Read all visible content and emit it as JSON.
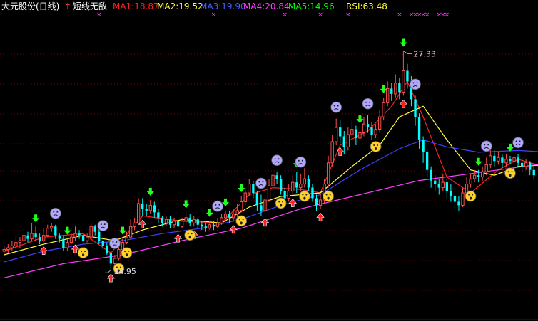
{
  "header": {
    "title": "大元股份(日线)",
    "indicator_arrow": "↑",
    "indicator_name": "短线无敌",
    "ma1": "MA1:18.87",
    "ma2": "MA2:19.52",
    "ma3": "MA3:19.90",
    "ma4": "MA4:20.84",
    "ma5": "MA5:14.96",
    "rsi": "RSI:63.48"
  },
  "colors": {
    "background": "#000000",
    "grid": "#7a0000",
    "up": "#ff5050",
    "down": "#00ffff",
    "ma1": "#ff2020",
    "ma2": "#ffff40",
    "ma3": "#4040ff",
    "ma4": "#ff40ff",
    "ma5": "#00ff00",
    "rsi": "#ffff40",
    "title": "#ffffff",
    "signal_x": "#ff40ff"
  },
  "chart_data": {
    "type": "candlestick",
    "ylim": [
      12.5,
      29.0
    ],
    "grid": true,
    "high_label": "27.33",
    "low_label": "14.95",
    "high_index": 101,
    "low_index": 27,
    "candles": [
      [
        16.0,
        16.1,
        15.8,
        16.3
      ],
      [
        16.1,
        16.2,
        15.9,
        16.4
      ],
      [
        16.2,
        16.3,
        16.0,
        16.6
      ],
      [
        16.3,
        16.5,
        16.1,
        16.9
      ],
      [
        16.5,
        16.6,
        16.2,
        16.8
      ],
      [
        16.6,
        16.9,
        16.4,
        17.2
      ],
      [
        16.9,
        16.7,
        16.5,
        17.1
      ],
      [
        16.7,
        17.0,
        16.6,
        17.6
      ],
      [
        17.0,
        16.8,
        16.6,
        17.4
      ],
      [
        16.8,
        16.6,
        16.4,
        17.0
      ],
      [
        16.6,
        16.9,
        16.5,
        17.3
      ],
      [
        16.9,
        17.3,
        16.8,
        17.5
      ],
      [
        17.3,
        17.4,
        17.1,
        17.6
      ],
      [
        17.4,
        16.9,
        16.7,
        17.5
      ],
      [
        16.9,
        16.7,
        16.5,
        17.0
      ],
      [
        16.7,
        16.2,
        16.0,
        16.9
      ],
      [
        16.2,
        16.5,
        16.0,
        16.7
      ],
      [
        16.5,
        16.8,
        16.4,
        17.0
      ],
      [
        16.8,
        17.0,
        16.6,
        17.4
      ],
      [
        17.0,
        16.9,
        16.7,
        17.2
      ],
      [
        16.9,
        16.6,
        16.4,
        17.0
      ],
      [
        16.6,
        16.8,
        16.5,
        17.0
      ],
      [
        16.8,
        17.4,
        16.7,
        17.6
      ],
      [
        17.4,
        17.1,
        16.9,
        17.5
      ],
      [
        17.1,
        16.6,
        16.4,
        17.3
      ],
      [
        16.6,
        16.3,
        16.1,
        16.8
      ],
      [
        16.3,
        15.9,
        15.8,
        16.5
      ],
      [
        15.9,
        15.3,
        14.95,
        16.0
      ],
      [
        15.3,
        15.6,
        15.1,
        15.8
      ],
      [
        15.6,
        16.1,
        15.5,
        16.3
      ],
      [
        16.1,
        16.5,
        16.0,
        16.7
      ],
      [
        16.5,
        16.8,
        16.4,
        17.1
      ],
      [
        16.8,
        17.4,
        16.7,
        17.8
      ],
      [
        17.4,
        17.6,
        17.2,
        17.9
      ],
      [
        17.6,
        18.7,
        17.5,
        19.0
      ],
      [
        18.7,
        18.4,
        18.0,
        19.0
      ],
      [
        18.4,
        18.3,
        18.0,
        18.7
      ],
      [
        18.3,
        18.6,
        18.1,
        18.9
      ],
      [
        18.6,
        18.2,
        17.9,
        18.8
      ],
      [
        18.2,
        17.9,
        17.6,
        18.4
      ],
      [
        17.9,
        17.6,
        17.4,
        18.0
      ],
      [
        17.6,
        17.8,
        17.4,
        18.0
      ],
      [
        17.8,
        17.5,
        17.3,
        18.0
      ],
      [
        17.5,
        17.7,
        17.3,
        17.9
      ],
      [
        17.7,
        17.4,
        17.2,
        17.8
      ],
      [
        17.4,
        17.7,
        17.3,
        17.9
      ],
      [
        17.7,
        17.9,
        17.5,
        18.2
      ],
      [
        17.9,
        17.6,
        17.4,
        18.1
      ],
      [
        17.6,
        17.8,
        17.4,
        18.0
      ],
      [
        17.8,
        17.5,
        17.3,
        17.9
      ],
      [
        17.5,
        17.4,
        17.2,
        17.7
      ],
      [
        17.4,
        17.3,
        17.1,
        17.6
      ],
      [
        17.3,
        17.5,
        17.2,
        17.7
      ],
      [
        17.5,
        17.4,
        17.2,
        17.7
      ],
      [
        17.4,
        17.6,
        17.3,
        17.9
      ],
      [
        17.6,
        17.9,
        17.5,
        18.1
      ],
      [
        17.9,
        18.1,
        17.7,
        18.3
      ],
      [
        18.1,
        17.9,
        17.6,
        18.3
      ],
      [
        17.9,
        18.1,
        17.7,
        18.4
      ],
      [
        18.1,
        18.3,
        17.9,
        18.7
      ],
      [
        18.3,
        18.8,
        18.2,
        19.1
      ],
      [
        18.8,
        19.3,
        18.6,
        19.6
      ],
      [
        19.3,
        19.8,
        19.1,
        20.1
      ],
      [
        19.8,
        19.3,
        19.0,
        20.0
      ],
      [
        19.3,
        18.6,
        18.3,
        19.4
      ],
      [
        18.6,
        18.3,
        18.0,
        19.2
      ],
      [
        18.3,
        18.9,
        18.1,
        19.5
      ],
      [
        18.9,
        19.7,
        18.8,
        20.1
      ],
      [
        19.7,
        20.3,
        19.5,
        20.7
      ],
      [
        20.3,
        20.1,
        19.8,
        20.5
      ],
      [
        20.1,
        19.4,
        19.2,
        20.3
      ],
      [
        19.4,
        19.0,
        18.7,
        19.6
      ],
      [
        19.0,
        19.4,
        18.8,
        19.8
      ],
      [
        19.4,
        19.9,
        19.2,
        20.3
      ],
      [
        19.9,
        19.6,
        19.3,
        20.5
      ],
      [
        19.6,
        19.8,
        19.4,
        20.4
      ],
      [
        19.8,
        20.1,
        19.6,
        20.7
      ],
      [
        20.1,
        19.6,
        19.4,
        20.3
      ],
      [
        19.6,
        19.0,
        18.8,
        19.8
      ],
      [
        19.0,
        18.6,
        18.3,
        19.2
      ],
      [
        18.6,
        18.9,
        18.4,
        19.3
      ],
      [
        18.9,
        19.8,
        18.7,
        20.1
      ],
      [
        19.8,
        21.0,
        19.6,
        21.4
      ],
      [
        21.0,
        22.2,
        20.8,
        22.6
      ],
      [
        22.2,
        23.0,
        22.0,
        23.5
      ],
      [
        23.0,
        22.5,
        22.1,
        23.4
      ],
      [
        22.5,
        21.9,
        21.5,
        22.8
      ],
      [
        21.9,
        22.6,
        21.7,
        23.0
      ],
      [
        22.6,
        22.9,
        22.3,
        23.4
      ],
      [
        22.9,
        22.4,
        22.0,
        23.1
      ],
      [
        22.4,
        22.7,
        22.2,
        23.0
      ],
      [
        22.7,
        23.2,
        22.5,
        23.6
      ],
      [
        23.2,
        23.0,
        22.7,
        23.7
      ],
      [
        23.0,
        22.6,
        22.3,
        23.3
      ],
      [
        22.6,
        22.9,
        22.4,
        23.2
      ],
      [
        22.9,
        23.6,
        22.7,
        24.0
      ],
      [
        23.6,
        24.4,
        23.4,
        24.7
      ],
      [
        24.4,
        25.2,
        24.2,
        25.6
      ],
      [
        25.2,
        24.9,
        24.5,
        25.5
      ],
      [
        24.9,
        25.5,
        24.7,
        26.0
      ],
      [
        25.5,
        25.0,
        24.6,
        25.8
      ],
      [
        25.0,
        26.2,
        24.8,
        27.33
      ],
      [
        26.2,
        25.6,
        25.2,
        26.6
      ],
      [
        25.6,
        24.6,
        24.2,
        25.9
      ],
      [
        24.6,
        23.6,
        23.1,
        24.8
      ],
      [
        23.6,
        22.3,
        21.8,
        23.8
      ],
      [
        22.3,
        21.6,
        21.0,
        22.5
      ],
      [
        21.6,
        20.6,
        20.2,
        21.8
      ],
      [
        20.6,
        20.0,
        19.6,
        20.8
      ],
      [
        20.0,
        19.8,
        19.4,
        20.3
      ],
      [
        19.8,
        19.6,
        19.2,
        20.1
      ],
      [
        19.6,
        19.9,
        19.4,
        20.4
      ],
      [
        19.9,
        19.4,
        19.0,
        20.1
      ],
      [
        19.4,
        19.1,
        18.8,
        19.8
      ],
      [
        19.1,
        18.8,
        18.4,
        19.3
      ],
      [
        18.8,
        18.6,
        18.3,
        19.1
      ],
      [
        18.6,
        19.3,
        18.5,
        19.6
      ],
      [
        19.3,
        19.8,
        19.1,
        20.2
      ],
      [
        19.8,
        20.1,
        19.6,
        20.4
      ],
      [
        20.1,
        20.3,
        19.9,
        20.6
      ],
      [
        20.3,
        20.2,
        19.9,
        20.6
      ],
      [
        20.2,
        20.5,
        20.0,
        20.8
      ],
      [
        20.5,
        20.9,
        20.3,
        21.3
      ],
      [
        20.9,
        21.4,
        20.7,
        21.8
      ],
      [
        21.4,
        21.1,
        20.8,
        21.7
      ],
      [
        21.1,
        21.3,
        20.9,
        21.6
      ],
      [
        21.3,
        21.0,
        20.7,
        21.5
      ],
      [
        21.0,
        21.2,
        20.8,
        21.5
      ],
      [
        21.2,
        21.1,
        20.9,
        21.4
      ],
      [
        21.1,
        21.3,
        20.9,
        21.6
      ],
      [
        21.3,
        21.0,
        20.8,
        21.5
      ],
      [
        21.0,
        20.8,
        20.5,
        21.3
      ],
      [
        20.8,
        21.0,
        20.6,
        21.2
      ],
      [
        21.0,
        20.6,
        20.3,
        21.1
      ],
      [
        20.6,
        20.3,
        20.1,
        20.9
      ]
    ],
    "series": [
      {
        "name": "MA1",
        "values": [
          [
            0,
            16.0
          ],
          [
            10,
            16.8
          ],
          [
            20,
            17.0
          ],
          [
            27,
            15.9
          ],
          [
            35,
            18.0
          ],
          [
            45,
            17.7
          ],
          [
            55,
            17.6
          ],
          [
            62,
            19.2
          ],
          [
            68,
            19.6
          ],
          [
            75,
            19.5
          ],
          [
            80,
            19.3
          ],
          [
            85,
            22.0
          ],
          [
            92,
            22.8
          ],
          [
            98,
            24.2
          ],
          [
            102,
            25.6
          ],
          [
            106,
            23.6
          ],
          [
            112,
            20.2
          ],
          [
            118,
            19.3
          ],
          [
            125,
            20.6
          ],
          [
            130,
            21.2
          ],
          [
            138,
            20.7
          ]
        ]
      },
      {
        "name": "MA2",
        "values": [
          [
            0,
            15.8
          ],
          [
            10,
            16.4
          ],
          [
            20,
            16.9
          ],
          [
            28,
            16.6
          ],
          [
            35,
            17.2
          ],
          [
            45,
            17.8
          ],
          [
            55,
            17.6
          ],
          [
            62,
            18.5
          ],
          [
            70,
            19.1
          ],
          [
            80,
            19.3
          ],
          [
            88,
            20.8
          ],
          [
            95,
            22.0
          ],
          [
            100,
            23.6
          ],
          [
            106,
            24.2
          ],
          [
            112,
            22.3
          ],
          [
            118,
            20.6
          ],
          [
            124,
            20.3
          ],
          [
            130,
            20.8
          ],
          [
            138,
            20.9
          ]
        ]
      },
      {
        "name": "MA3",
        "values": [
          [
            0,
            15.4
          ],
          [
            10,
            16.0
          ],
          [
            20,
            16.4
          ],
          [
            30,
            16.6
          ],
          [
            40,
            17.0
          ],
          [
            50,
            17.3
          ],
          [
            60,
            17.8
          ],
          [
            70,
            18.6
          ],
          [
            80,
            19.2
          ],
          [
            90,
            20.6
          ],
          [
            100,
            21.8
          ],
          [
            106,
            22.3
          ],
          [
            112,
            21.9
          ],
          [
            120,
            21.6
          ],
          [
            130,
            21.7
          ],
          [
            138,
            21.6
          ]
        ]
      },
      {
        "name": "MA4",
        "values": [
          [
            0,
            14.5
          ],
          [
            15,
            15.3
          ],
          [
            30,
            15.8
          ],
          [
            45,
            16.6
          ],
          [
            60,
            17.3
          ],
          [
            75,
            18.4
          ],
          [
            90,
            19.2
          ],
          [
            105,
            20.0
          ],
          [
            115,
            20.3
          ],
          [
            125,
            20.6
          ],
          [
            138,
            21.0
          ]
        ]
      },
      {
        "name": "MA5",
        "values": []
      }
    ],
    "buy_signals": [
      10,
      18,
      27,
      35,
      44,
      48,
      58,
      66,
      73,
      80,
      85,
      101
    ],
    "sell_signals": [
      8,
      16,
      30,
      37,
      46,
      52,
      56,
      60,
      74,
      90,
      96,
      101,
      120,
      128
    ],
    "sad_face_indices": [
      13,
      25,
      28,
      54,
      65,
      69,
      75,
      84,
      92,
      104,
      122,
      130
    ],
    "scared_face_indices": [
      20,
      29,
      31,
      47,
      60,
      70,
      76,
      82,
      94,
      118,
      128
    ],
    "signal_x_indices": [
      24,
      53,
      71,
      80,
      87,
      100,
      103,
      104,
      105,
      106,
      107,
      110,
      111,
      112
    ]
  }
}
